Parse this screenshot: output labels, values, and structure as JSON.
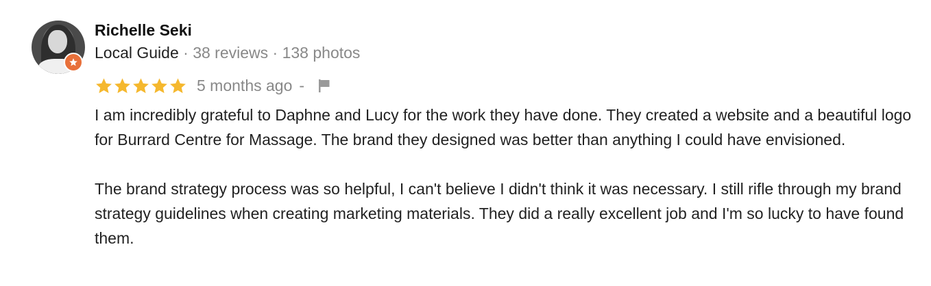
{
  "review": {
    "author": "Richelle Seki",
    "guide_label": "Local Guide",
    "reviews_count": "38 reviews",
    "photos_count": "138 photos",
    "meta_separator": "·",
    "rating": 5,
    "rating_max": 5,
    "time_ago": "5 months ago",
    "dash": "-",
    "paragraphs": [
      "I am incredibly grateful to Daphne and Lucy for the work they have done. They created a website and a beautiful logo for Burrard Centre for Massage. The brand they designed was better than anything I could have envisioned.",
      "The brand strategy process was so helpful, I can't believe I didn't think it was necessary. I still rifle through my brand strategy guidelines when creating  marketing materials. They did a really excellent job and I'm so lucky to have found them."
    ]
  },
  "icons": {
    "badge": "local-guide-star-icon",
    "star": "star-icon",
    "flag": "flag-icon"
  },
  "colors": {
    "star": "#F5B82E",
    "badge": "#E8703A",
    "muted_text": "#888888",
    "text": "#222222"
  }
}
